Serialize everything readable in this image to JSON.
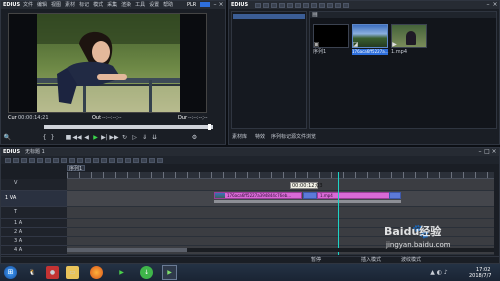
{
  "player": {
    "logo": "EDIUS",
    "menu": [
      "文件",
      "编辑",
      "视图",
      "素材",
      "标记",
      "模式",
      "采集",
      "渲染",
      "工具",
      "设置",
      "帮助"
    ],
    "mode": "PLR",
    "tc_in": "00:00:14;21",
    "tc_out": "--:--:--;--",
    "tc_dur": "--:--:--;--"
  },
  "bin": {
    "logo": "EDIUS",
    "folder_label": "",
    "thumbs": [
      {
        "name": "序列1"
      },
      {
        "name": "176aca6ff5227a..."
      },
      {
        "name": "1.mp4"
      }
    ],
    "tabs": [
      "素材库",
      "特效",
      "序列标记",
      "源文件浏览"
    ]
  },
  "timeline": {
    "logo": "EDIUS",
    "project": "无标题 1",
    "sequence": "序列1",
    "timecode_popup": "00:00:12;03",
    "clip_main": "176aca6ff5227a394844c76eb...",
    "clip_second": "1.mp4",
    "tracks": [
      "V",
      "1 VA",
      "T",
      "1 A",
      "2 A",
      "3 A",
      "4 A"
    ],
    "status_left": "暂停",
    "status_mid": "插入模式",
    "status_right": "波纹模式"
  },
  "taskbar": {
    "time": "17:02",
    "date": "2018/7/7"
  },
  "watermark": {
    "brand": "Baidu经验",
    "url": "jingyan.baidu.com"
  },
  "colors": {
    "accent": "#2e6fdc",
    "clip_pink": "#d86ad6",
    "clip_blue": "#5c7ad8",
    "cursor": "#1dd3c7"
  }
}
